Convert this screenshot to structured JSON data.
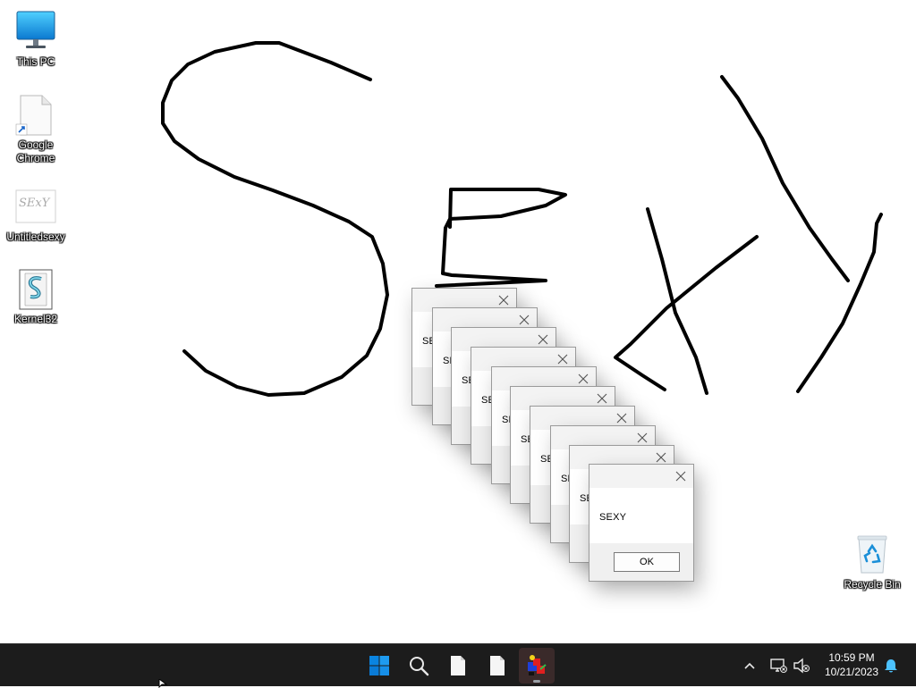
{
  "desktop": {
    "icons": [
      {
        "label": "This PC",
        "icon": "monitor-icon"
      },
      {
        "label": "Google Chrome",
        "icon": "blank-file-shortcut-icon"
      },
      {
        "label": "Untitledsexy",
        "icon": "image-thumbnail-icon",
        "thumb_text": "SExY"
      },
      {
        "label": "Kernel32",
        "icon": "script-scroll-icon"
      }
    ],
    "recycle_bin": {
      "label": "Recycle Bin",
      "icon": "recycle-bin-icon"
    },
    "drawing": {
      "text_drawn": "SExy",
      "stroke_color": "#000000"
    }
  },
  "dialogs": {
    "count": 10,
    "message": "SEXY",
    "ok_label": "OK",
    "partial_message": "SE"
  },
  "taskbar": {
    "items": [
      {
        "name": "start",
        "icon": "windows-logo-icon"
      },
      {
        "name": "search",
        "icon": "search-icon"
      },
      {
        "name": "file-1",
        "icon": "file-icon"
      },
      {
        "name": "file-2",
        "icon": "file-icon"
      },
      {
        "name": "running-app",
        "icon": "app-icon",
        "active": true
      }
    ],
    "tray": {
      "time": "10:59 PM",
      "date": "10/21/2023"
    }
  },
  "colors": {
    "taskbar_bg": "#1c1c1c",
    "start_blue": "#0078d4",
    "notification_blue": "#4cc2ff"
  }
}
